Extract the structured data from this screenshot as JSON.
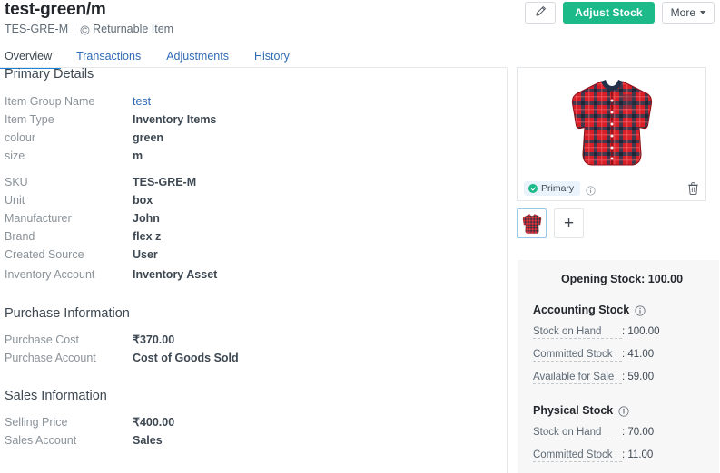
{
  "header": {
    "title": "test-green/m",
    "sku_text": "TES-GRE-M",
    "returnable_label": "Returnable Item",
    "returnable_icon": "return-circular-arrow-icon",
    "edit_icon": "pencil-icon",
    "adjust_stock_label": "Adjust Stock",
    "more_label": "More",
    "accent_green": "#1bba88",
    "link_blue": "#2f6bb5",
    "tab_indicator_blue": "#1f84d6"
  },
  "tabs": [
    {
      "label": "Overview",
      "active": true
    },
    {
      "label": "Transactions",
      "active": false
    },
    {
      "label": "Adjustments",
      "active": false
    },
    {
      "label": "History",
      "active": false
    }
  ],
  "sections": {
    "primary_details": {
      "title": "Primary Details",
      "fields": [
        {
          "label": "Item Group Name",
          "value": "test",
          "link": true
        },
        {
          "label": "Item Type",
          "value": "Inventory Items",
          "link": false
        },
        {
          "label": "colour",
          "value": "green",
          "link": false
        },
        {
          "label": "size",
          "value": "m",
          "link": false
        },
        {
          "label": "SKU",
          "value": "TES-GRE-M",
          "link": false
        },
        {
          "label": "Unit",
          "value": "box",
          "link": false
        },
        {
          "label": "Manufacturer",
          "value": "John",
          "link": false
        },
        {
          "label": "Brand",
          "value": "flex z",
          "link": false
        },
        {
          "label": "Created Source",
          "value": "User",
          "link": false
        },
        {
          "label": "Inventory Account",
          "value": "Inventory Asset",
          "link": false
        }
      ]
    },
    "purchase_information": {
      "title": "Purchase Information",
      "fields": [
        {
          "label": "Purchase Cost",
          "value": "₹370.00",
          "link": false
        },
        {
          "label": "Purchase Account",
          "value": "Cost of Goods Sold",
          "link": false
        }
      ]
    },
    "sales_information": {
      "title": "Sales Information",
      "fields": [
        {
          "label": "Selling Price",
          "value": "₹400.00",
          "link": false
        },
        {
          "label": "Sales Account",
          "value": "Sales",
          "link": false
        }
      ]
    }
  },
  "image_panel": {
    "primary_badge_label": "Primary",
    "primary_badge_icon": "check-circle-icon",
    "info_icon": "info-icon",
    "delete_icon": "trash-icon",
    "add_thumb_label": "+",
    "product_image_alt": "red-plaid-flannel-shirt"
  },
  "stock_panel": {
    "opening_stock": "Opening Stock: 100.00",
    "accounting": {
      "title": "Accounting Stock",
      "info_icon": "info-icon",
      "rows": [
        {
          "name": "Stock on Hand",
          "value": ": 100.00"
        },
        {
          "name": "Committed Stock",
          "value": ": 41.00"
        },
        {
          "name": "Available for Sale",
          "value": ": 59.00"
        }
      ]
    },
    "physical": {
      "title": "Physical Stock",
      "info_icon": "info-icon",
      "rows": [
        {
          "name": "Stock on Hand",
          "value": ": 70.00"
        },
        {
          "name": "Committed Stock",
          "value": ": 11.00"
        }
      ]
    }
  }
}
